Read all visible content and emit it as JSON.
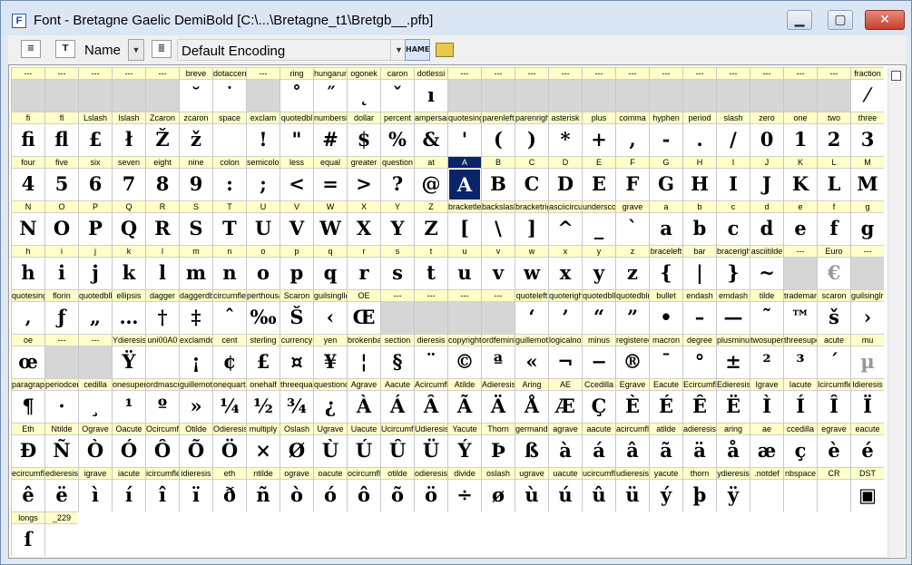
{
  "window": {
    "title": "Font - Bretagne Gaelic DemiBold [C:\\...\\Bretagne_t1\\Bretgb__.pfb]",
    "app_icon": "F",
    "minimize": "▁",
    "maximize": "▢",
    "close": "✕"
  },
  "toolbar": {
    "name_label": "Name",
    "dropdown_arrow": "▼",
    "encoding": "Default Encoding",
    "hame_label": "HAME"
  },
  "rows": [
    [
      [
        "---",
        ""
      ],
      [
        "---",
        ""
      ],
      [
        "---",
        ""
      ],
      [
        "---",
        ""
      ],
      [
        "---",
        ""
      ],
      [
        "breve",
        "˘"
      ],
      [
        "dotaccent",
        "˙"
      ],
      [
        "---",
        ""
      ],
      [
        "ring",
        "˚"
      ],
      [
        "hungarumlaut",
        "˝"
      ],
      [
        "ogonek",
        "˛"
      ],
      [
        "caron",
        "ˇ"
      ],
      [
        "dotlessi",
        "ı"
      ],
      [
        "---",
        ""
      ],
      [
        "---",
        ""
      ],
      [
        "---",
        ""
      ],
      [
        "---",
        ""
      ],
      [
        "---",
        ""
      ],
      [
        "---",
        ""
      ],
      [
        "---",
        ""
      ],
      [
        "---",
        ""
      ],
      [
        "---",
        ""
      ],
      [
        "---",
        ""
      ],
      [
        "---",
        ""
      ],
      [
        "---",
        ""
      ],
      [
        "fraction",
        "⁄"
      ]
    ],
    [
      [
        "fi",
        "ﬁ"
      ],
      [
        "fl",
        "ﬂ"
      ],
      [
        "Lslash",
        "£"
      ],
      [
        "lslash",
        "ł"
      ],
      [
        "Zcaron",
        "Ž"
      ],
      [
        "zcaron",
        "ž"
      ],
      [
        "space",
        ""
      ],
      [
        "exclam",
        "!"
      ],
      [
        "quotedbl",
        "\""
      ],
      [
        "numbersign",
        "#"
      ],
      [
        "dollar",
        "$"
      ],
      [
        "percent",
        "%"
      ],
      [
        "ampersand",
        "&"
      ],
      [
        "quotesingle",
        "'"
      ],
      [
        "parenleft",
        "("
      ],
      [
        "parenright",
        ")"
      ],
      [
        "asterisk",
        "*"
      ],
      [
        "plus",
        "+"
      ],
      [
        "comma",
        ","
      ],
      [
        "hyphen",
        "-"
      ],
      [
        "period",
        "."
      ],
      [
        "slash",
        "/"
      ],
      [
        "zero",
        "0"
      ],
      [
        "one",
        "1"
      ],
      [
        "two",
        "2"
      ],
      [
        "three",
        "3"
      ]
    ],
    [
      [
        "four",
        "4"
      ],
      [
        "five",
        "5"
      ],
      [
        "six",
        "6"
      ],
      [
        "seven",
        "7"
      ],
      [
        "eight",
        "8"
      ],
      [
        "nine",
        "9"
      ],
      [
        "colon",
        ":"
      ],
      [
        "semicolon",
        ";"
      ],
      [
        "less",
        "<"
      ],
      [
        "equal",
        "="
      ],
      [
        "greater",
        ">"
      ],
      [
        "question",
        "?"
      ],
      [
        "at",
        "@"
      ],
      [
        "A",
        "A"
      ],
      [
        "B",
        "B"
      ],
      [
        "C",
        "C"
      ],
      [
        "D",
        "D"
      ],
      [
        "E",
        "E"
      ],
      [
        "F",
        "F"
      ],
      [
        "G",
        "G"
      ],
      [
        "H",
        "H"
      ],
      [
        "I",
        "I"
      ],
      [
        "J",
        "J"
      ],
      [
        "K",
        "K"
      ],
      [
        "L",
        "L"
      ],
      [
        "M",
        "M"
      ]
    ],
    [
      [
        "N",
        "N"
      ],
      [
        "O",
        "O"
      ],
      [
        "P",
        "P"
      ],
      [
        "Q",
        "Q"
      ],
      [
        "R",
        "R"
      ],
      [
        "S",
        "S"
      ],
      [
        "T",
        "T"
      ],
      [
        "U",
        "U"
      ],
      [
        "V",
        "V"
      ],
      [
        "W",
        "W"
      ],
      [
        "X",
        "X"
      ],
      [
        "Y",
        "Y"
      ],
      [
        "Z",
        "Z"
      ],
      [
        "bracketleft",
        "["
      ],
      [
        "backslash",
        "\\"
      ],
      [
        "bracketright",
        "]"
      ],
      [
        "asciicircum",
        "^"
      ],
      [
        "underscore",
        "_"
      ],
      [
        "grave",
        "`"
      ],
      [
        "a",
        "a"
      ],
      [
        "b",
        "b"
      ],
      [
        "c",
        "c"
      ],
      [
        "d",
        "d"
      ],
      [
        "e",
        "e"
      ],
      [
        "f",
        "f"
      ],
      [
        "g",
        "g"
      ]
    ],
    [
      [
        "h",
        "h"
      ],
      [
        "i",
        "i"
      ],
      [
        "j",
        "j"
      ],
      [
        "k",
        "k"
      ],
      [
        "l",
        "l"
      ],
      [
        "m",
        "m"
      ],
      [
        "n",
        "n"
      ],
      [
        "o",
        "o"
      ],
      [
        "p",
        "p"
      ],
      [
        "q",
        "q"
      ],
      [
        "r",
        "r"
      ],
      [
        "s",
        "s"
      ],
      [
        "t",
        "t"
      ],
      [
        "u",
        "u"
      ],
      [
        "v",
        "v"
      ],
      [
        "w",
        "w"
      ],
      [
        "x",
        "x"
      ],
      [
        "y",
        "y"
      ],
      [
        "z",
        "z"
      ],
      [
        "braceleft",
        "{"
      ],
      [
        "bar",
        "|"
      ],
      [
        "braceright",
        "}"
      ],
      [
        "asciitilde",
        "~"
      ],
      [
        "---",
        ""
      ],
      [
        "Euro",
        "€"
      ],
      [
        "---",
        ""
      ]
    ],
    [
      [
        "quotesinglbase",
        "‚"
      ],
      [
        "florin",
        "ƒ"
      ],
      [
        "quotedblbase",
        "„"
      ],
      [
        "ellipsis",
        "…"
      ],
      [
        "dagger",
        "†"
      ],
      [
        "daggerdbl",
        "‡"
      ],
      [
        "circumflex",
        "ˆ"
      ],
      [
        "perthousand",
        "‰"
      ],
      [
        "Scaron",
        "Š"
      ],
      [
        "guilsinglleft",
        "‹"
      ],
      [
        "OE",
        "Œ"
      ],
      [
        "---",
        ""
      ],
      [
        "---",
        ""
      ],
      [
        "---",
        ""
      ],
      [
        "---",
        ""
      ],
      [
        "quoteleft",
        "‘"
      ],
      [
        "quoteright",
        "’"
      ],
      [
        "quotedblleft",
        "“"
      ],
      [
        "quotedblright",
        "”"
      ],
      [
        "bullet",
        "•"
      ],
      [
        "endash",
        "–"
      ],
      [
        "emdash",
        "—"
      ],
      [
        "tilde",
        "˜"
      ],
      [
        "trademark",
        "™"
      ],
      [
        "scaron",
        "š"
      ],
      [
        "guilsinglright",
        "›"
      ]
    ],
    [
      [
        "oe",
        "œ"
      ],
      [
        "---",
        ""
      ],
      [
        "---",
        ""
      ],
      [
        "Ydieresis",
        "Ÿ"
      ],
      [
        "uni00A0",
        ""
      ],
      [
        "exclamdown",
        "¡"
      ],
      [
        "cent",
        "¢"
      ],
      [
        "sterling",
        "£"
      ],
      [
        "currency",
        "¤"
      ],
      [
        "yen",
        "¥"
      ],
      [
        "brokenbar",
        "¦"
      ],
      [
        "section",
        "§"
      ],
      [
        "dieresis",
        "¨"
      ],
      [
        "copyright",
        "©"
      ],
      [
        "ordfeminine",
        "ª"
      ],
      [
        "guillemotleft",
        "«"
      ],
      [
        "logicalnot",
        "¬"
      ],
      [
        "minus",
        "−"
      ],
      [
        "registered",
        "®"
      ],
      [
        "macron",
        "¯"
      ],
      [
        "degree",
        "°"
      ],
      [
        "plusminus",
        "±"
      ],
      [
        "twosuperior",
        "²"
      ],
      [
        "threesuperior",
        "³"
      ],
      [
        "acute",
        "´"
      ],
      [
        "mu",
        "µ"
      ]
    ],
    [
      [
        "paragraph",
        "¶"
      ],
      [
        "periodcentered",
        "·"
      ],
      [
        "cedilla",
        "¸"
      ],
      [
        "onesuperior",
        "¹"
      ],
      [
        "ordmasculine",
        "º"
      ],
      [
        "guillemotright",
        "»"
      ],
      [
        "onequarter",
        "¼"
      ],
      [
        "onehalf",
        "½"
      ],
      [
        "threequarters",
        "¾"
      ],
      [
        "questiondown",
        "¿"
      ],
      [
        "Agrave",
        "À"
      ],
      [
        "Aacute",
        "Á"
      ],
      [
        "Acircumflex",
        "Â"
      ],
      [
        "Atilde",
        "Ã"
      ],
      [
        "Adieresis",
        "Ä"
      ],
      [
        "Aring",
        "Å"
      ],
      [
        "AE",
        "Æ"
      ],
      [
        "Ccedilla",
        "Ç"
      ],
      [
        "Egrave",
        "È"
      ],
      [
        "Eacute",
        "É"
      ],
      [
        "Ecircumflex",
        "Ê"
      ],
      [
        "Edieresis",
        "Ë"
      ],
      [
        "Igrave",
        "Ì"
      ],
      [
        "Iacute",
        "Í"
      ],
      [
        "Icircumflex",
        "Î"
      ],
      [
        "Idieresis",
        "Ï"
      ]
    ],
    [
      [
        "Eth",
        "Ð"
      ],
      [
        "Ntilde",
        "Ñ"
      ],
      [
        "Ograve",
        "Ò"
      ],
      [
        "Oacute",
        "Ó"
      ],
      [
        "Ocircumflex",
        "Ô"
      ],
      [
        "Otilde",
        "Õ"
      ],
      [
        "Odieresis",
        "Ö"
      ],
      [
        "multiply",
        "×"
      ],
      [
        "Oslash",
        "Ø"
      ],
      [
        "Ugrave",
        "Ù"
      ],
      [
        "Uacute",
        "Ú"
      ],
      [
        "Ucircumflex",
        "Û"
      ],
      [
        "Udieresis",
        "Ü"
      ],
      [
        "Yacute",
        "Ý"
      ],
      [
        "Thorn",
        "Þ"
      ],
      [
        "germandbls",
        "ß"
      ],
      [
        "agrave",
        "à"
      ],
      [
        "aacute",
        "á"
      ],
      [
        "acircumflex",
        "â"
      ],
      [
        "atilde",
        "ã"
      ],
      [
        "adieresis",
        "ä"
      ],
      [
        "aring",
        "å"
      ],
      [
        "ae",
        "æ"
      ],
      [
        "ccedilla",
        "ç"
      ],
      [
        "egrave",
        "è"
      ],
      [
        "eacute",
        "é"
      ]
    ],
    [
      [
        "ecircumflex",
        "ê"
      ],
      [
        "edieresis",
        "ë"
      ],
      [
        "igrave",
        "ì"
      ],
      [
        "iacute",
        "í"
      ],
      [
        "icircumflex",
        "î"
      ],
      [
        "idieresis",
        "ï"
      ],
      [
        "eth",
        "ð"
      ],
      [
        "ntilde",
        "ñ"
      ],
      [
        "ograve",
        "ò"
      ],
      [
        "oacute",
        "ó"
      ],
      [
        "ocircumflex",
        "ô"
      ],
      [
        "otilde",
        "õ"
      ],
      [
        "odieresis",
        "ö"
      ],
      [
        "divide",
        "÷"
      ],
      [
        "oslash",
        "ø"
      ],
      [
        "ugrave",
        "ù"
      ],
      [
        "uacute",
        "ú"
      ],
      [
        "ucircumflex",
        "û"
      ],
      [
        "udieresis",
        "ü"
      ],
      [
        "yacute",
        "ý"
      ],
      [
        "thorn",
        "þ"
      ],
      [
        "ydieresis",
        "ÿ"
      ],
      [
        ".notdef",
        ""
      ],
      [
        "nbspace",
        ""
      ],
      [
        "CR",
        ""
      ],
      [
        "DST",
        "▣"
      ]
    ],
    [
      [
        "longs",
        "ſ"
      ],
      [
        "_229",
        ""
      ]
    ]
  ],
  "selected": "A",
  "grey_glyphs": [
    "Euro",
    "mu"
  ]
}
